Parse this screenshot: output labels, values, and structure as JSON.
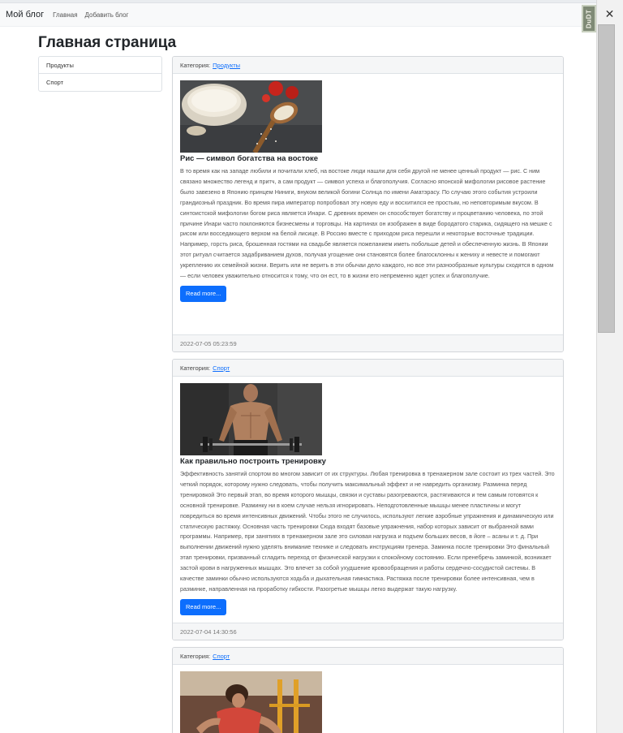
{
  "navbar": {
    "brand": "Мой блог",
    "links": [
      "Главная",
      "Добавить блог"
    ]
  },
  "extension_badge": "DuDT",
  "page_title": "Главная страница",
  "sidebar": {
    "items": [
      {
        "label": "Продукты"
      },
      {
        "label": "Спорт"
      }
    ]
  },
  "category_prefix": "Категория:",
  "posts": [
    {
      "category": "Продукты",
      "image": "rice-bowl-photo",
      "title": "Рис — символ богатства на востоке",
      "text": "В то время как на западе любили и почитали хлеб, на востоке люди нашли для себя другой не менее ценный продукт — рис. С ним связано множество легенд и притч, а сам продукт — символ успеха и благополучия. Согласно японской мифологии рисовое растение было завезено в Японию принцем Ниниги, внуком великой богини Солнца по имени Аматэрасу. По случаю этого события устроили грандиозный праздник. Во время пира император попробовал эту новую еду и восхитился ее простым, но неповторимым вкусом. В синтоистской мифологии богом риса является Инари. С древних времен он способствует богатству и процветанию человека, по этой причине Инари часто поклоняются бизнесмены и торговцы. На картинах он изображен в виде бородатого старика, сидящего на мешке с рисом или восседающего верхом на белой лисице. В Россию вместе с приходом риса перешли и некоторые восточные традиции. Например, горсть риса, брошенная гостями на свадьбе является пожеланием иметь побольше детей и обеспеченную жизнь. В Японии этот ритуал считается задабриванием духов, получая угощение они становятся более благосклонны к жениху и невесте и помогают укреплению их семейной жизни. Верить или не верить в эти обычаи дело каждого, но все эти разнообразные культуры сходятся в одном — если человек уважительно относится к тому, что он ест, то в жизни его непременно ждет успех и благополучие.",
      "button": "Read more...",
      "date": "2022-07-05 05:23:59"
    },
    {
      "category": "Спорт",
      "image": "athlete-barbell-photo",
      "title": "Как правильно построить тренировку",
      "text": "Эффективность занятий спортом во многом зависит от их структуры. Любая тренировка в тренажерном зале состоит из трех частей. Это четкий порядок, которому нужно следовать, чтобы получить максимальный эффект и не навредить организму. Разминка перед тренировкой Это первый этап, во время которого мышцы, связки и суставы разогреваются, растягиваются и тем самым готовятся к основной тренировке. Разминку ни в коем случае нельзя игнорировать. Неподготовленные мышцы менее пластичны и могут повредиться во время интенсивных движений. Чтобы этого не случилось, используют легкие аэробные упражнения и динамическую или статическую растяжку. Основная часть тренировки Сюда входят базовые упражнения, набор которых зависит от выбранной вами программы. Например, при занятиях в тренажерном зале это силовая нагрузка и подъем больших весов, в йоге – асаны и т. д. При выполнении движений нужно уделять внимание технике и следовать инструкциям тренера. Заминка после тренировки Это финальный этап тренировки, призванный сгладить переход от физической нагрузки к спокойному состоянию. Если пренебречь заминкой, возникает застой крови в нагруженных мышцах. Это влечет за собой ухудшение кровообращения и работы сердечно-сосудистой системы. В качестве заминки обычно используются ходьба и дыхательная гимнастика. Растяжка после тренировки более интенсивная, чем в разминке, направленная на проработку гибкости. Разогретые мышцы легко выдержат такую нагрузку.",
      "button": "Read more...",
      "date": "2022-07-04 14:30:56"
    },
    {
      "category": "Спорт",
      "image": "woman-workout-photo"
    }
  ]
}
